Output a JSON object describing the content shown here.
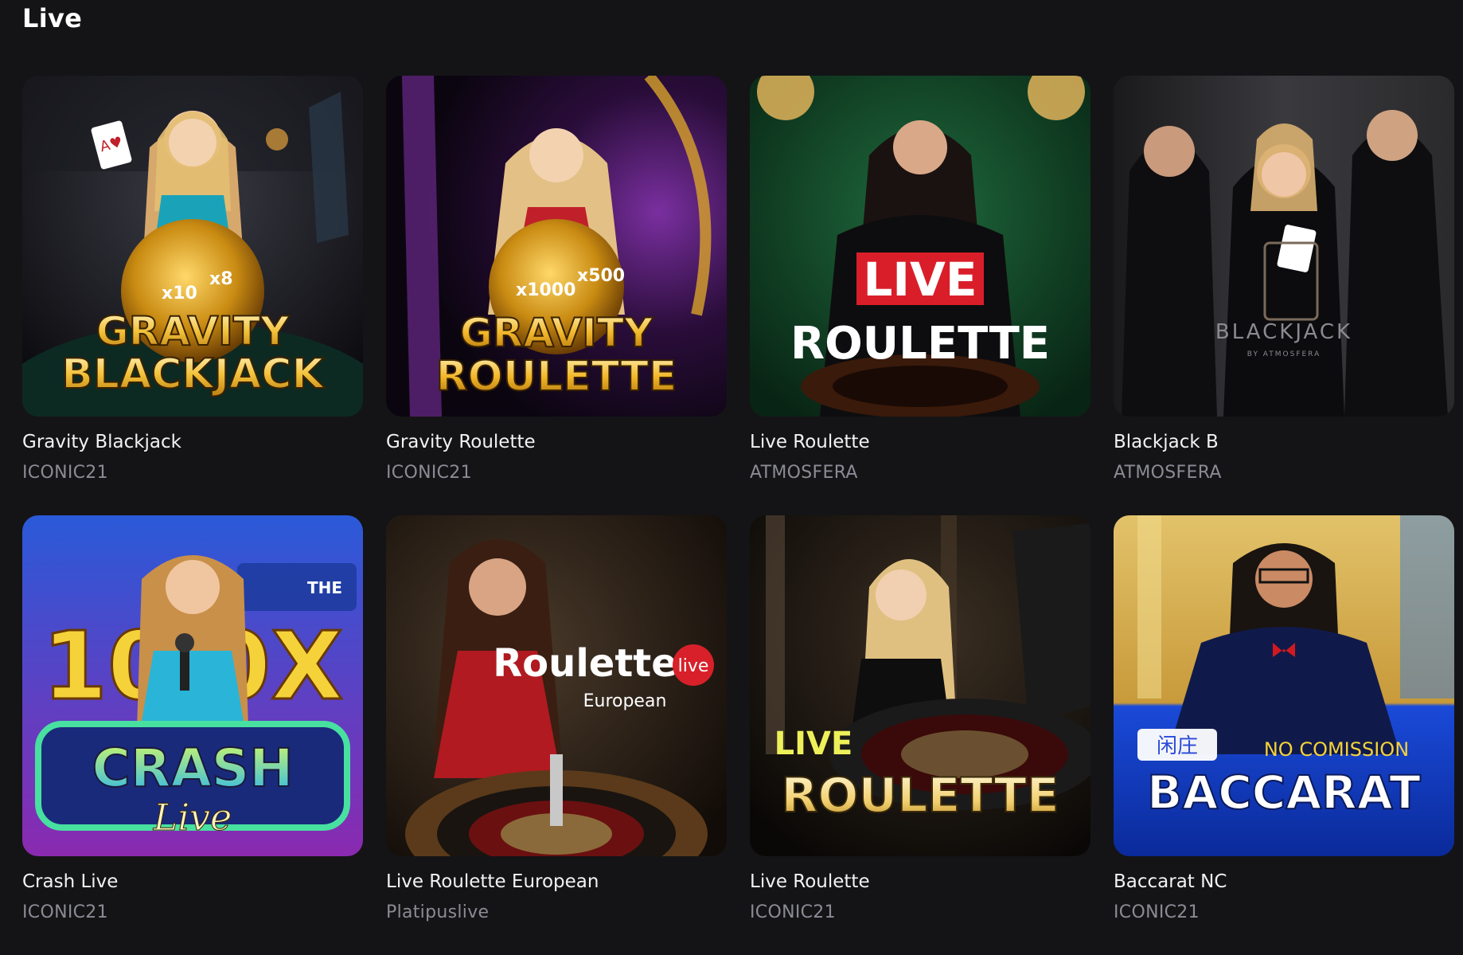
{
  "section": {
    "title": "Live"
  },
  "games": [
    {
      "name": "Gravity Blackjack",
      "provider": "ICONIC21",
      "art": {
        "line1": "GRAVITY",
        "line2": "BLACKJACK",
        "badges": [
          "x10",
          "x8"
        ]
      }
    },
    {
      "name": "Gravity Roulette",
      "provider": "ICONIC21",
      "art": {
        "line1": "GRAVITY",
        "line2": "ROULETTE",
        "badges": [
          "x1000",
          "x500"
        ]
      }
    },
    {
      "name": "Live Roulette",
      "provider": "ATMOSFERA",
      "art": {
        "line1": "LIVE",
        "line2": "ROULETTE"
      }
    },
    {
      "name": "Blackjack B",
      "provider": "ATMOSFERA",
      "art": {
        "line1": "BLACKJACK",
        "line2": "BY ATMOSFERA"
      }
    },
    {
      "name": "Crash Live",
      "provider": "ICONIC21",
      "art": {
        "line1": "CRASH",
        "line2": "Live",
        "line3": "10 0X",
        "sign": "THE"
      }
    },
    {
      "name": "Live Roulette European",
      "provider": "Platipuslive",
      "art": {
        "line1": "Roulette",
        "line2": "European",
        "badge": "live"
      }
    },
    {
      "name": "Live Roulette",
      "provider": "ICONIC21",
      "art": {
        "line1": "LIVE",
        "line2": "ROULETTE"
      }
    },
    {
      "name": "Baccarat NC",
      "provider": "ICONIC21",
      "art": {
        "line1": "NO COMISSION",
        "line2": "BACCARAT",
        "line3": "闲庄"
      }
    }
  ]
}
